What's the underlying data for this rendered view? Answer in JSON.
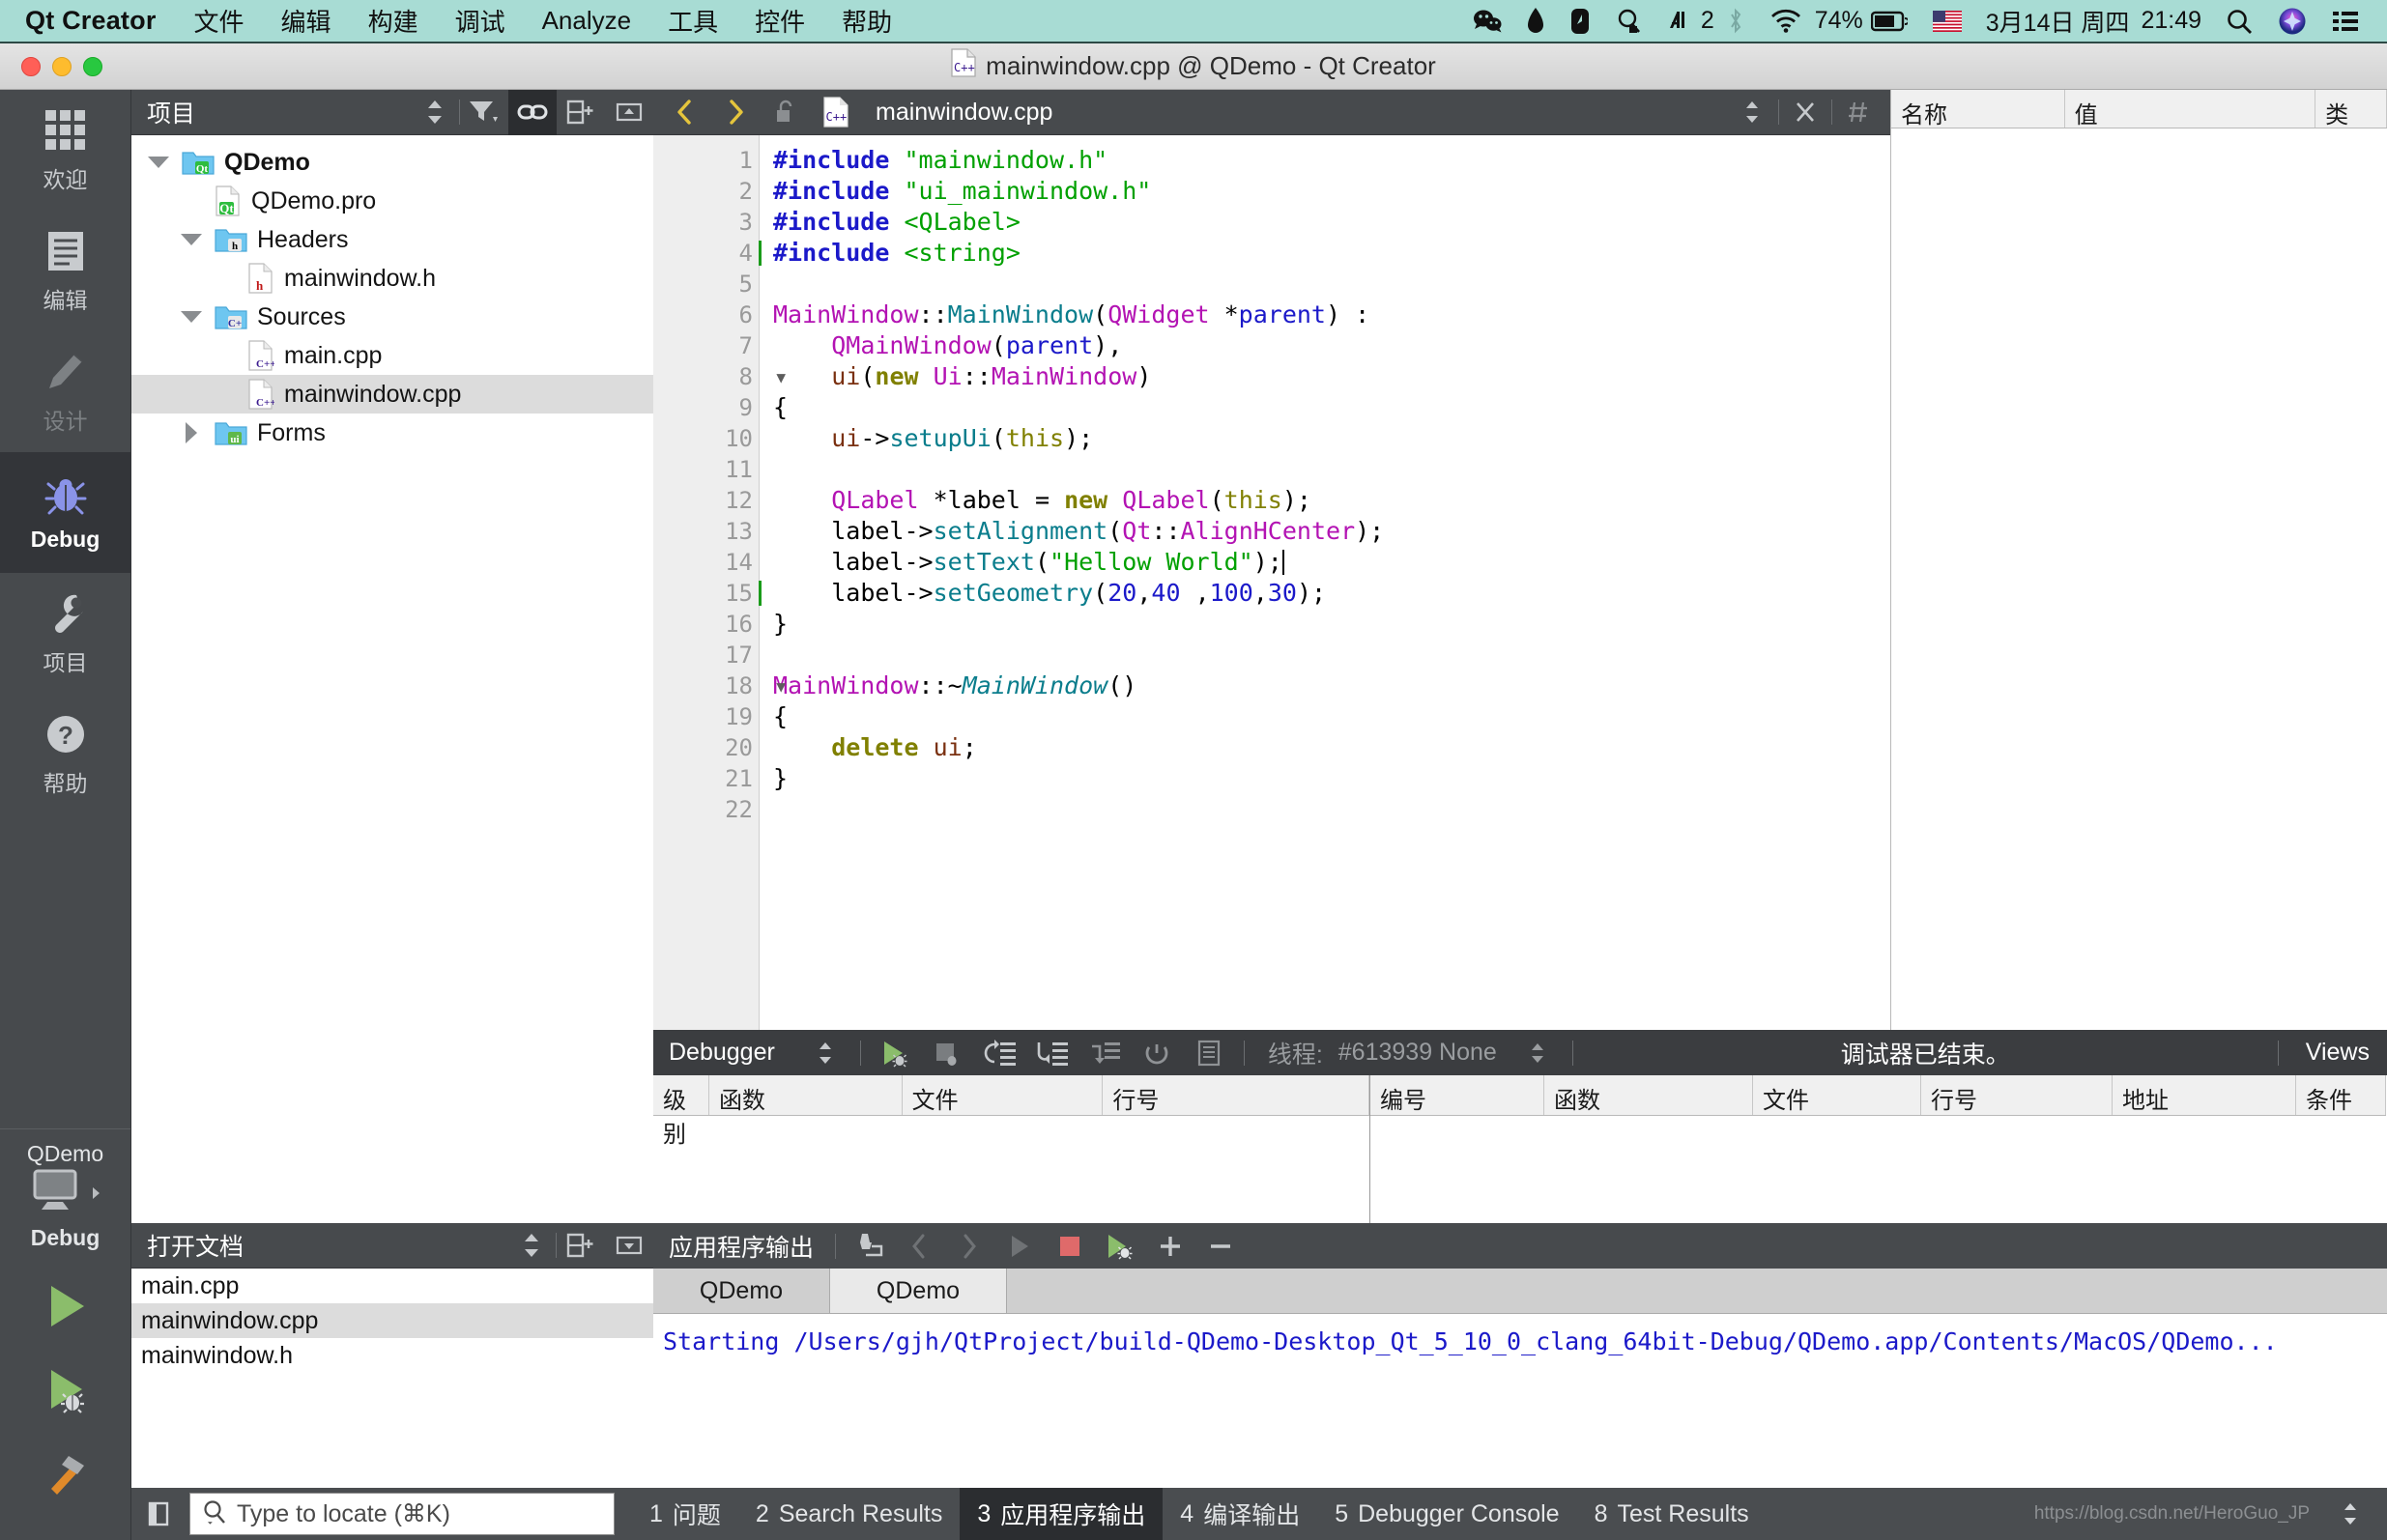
{
  "macbar": {
    "app_name": "Qt Creator",
    "menus": [
      "文件",
      "编辑",
      "构建",
      "调试",
      "Analyze",
      "工具",
      "控件",
      "帮助"
    ],
    "status_icons": [
      "wechat-icon",
      "fountain-pen-icon",
      "evernote-icon",
      "alfred-icon",
      "audio-2-icon"
    ],
    "audio_count": "2",
    "bluetooth_icon": "bluetooth-icon",
    "wifi_icon": "wifi-icon",
    "battery_percent": "74%",
    "input_source": "us-flag-icon",
    "date": "3月14日 周四",
    "time": "21:49",
    "spotlight_icon": "search-icon",
    "siri_icon": "siri-icon",
    "controlcenter_icon": "list-icon"
  },
  "window": {
    "title": "mainwindow.cpp @ QDemo - Qt Creator",
    "title_icon": "cpp-file-icon"
  },
  "modebar": {
    "items": [
      {
        "label": "欢迎",
        "icon": "grid-icon",
        "state": "normal"
      },
      {
        "label": "编辑",
        "icon": "document-icon",
        "state": "normal"
      },
      {
        "label": "设计",
        "icon": "pencil-icon",
        "state": "disabled"
      },
      {
        "label": "Debug",
        "icon": "bug-icon",
        "state": "active"
      },
      {
        "label": "项目",
        "icon": "wrench-icon",
        "state": "normal"
      },
      {
        "label": "帮助",
        "icon": "question-icon",
        "state": "normal"
      }
    ],
    "kit": {
      "project": "QDemo",
      "config": "Debug",
      "icon": "monitor-icon"
    },
    "run_buttons": [
      "run-icon",
      "debug-icon",
      "build-hammer-icon"
    ]
  },
  "project_panel": {
    "title": "项目",
    "tools": [
      "filter-selector-icon",
      "filter-funnel-icon",
      "link-sync-icon",
      "split-add-icon",
      "close-panel-icon"
    ],
    "tree": [
      {
        "label": "QDemo",
        "icon": "qt-folder-icon",
        "indent": 0,
        "arrow": "down",
        "bold": true,
        "selected": false
      },
      {
        "label": "QDemo.pro",
        "icon": "qt-file-icon",
        "indent": 1,
        "arrow": "none",
        "bold": false,
        "selected": false
      },
      {
        "label": "Headers",
        "icon": "h-folder-icon",
        "indent": 1,
        "arrow": "down",
        "bold": false,
        "selected": false
      },
      {
        "label": "mainwindow.h",
        "icon": "h-file-icon",
        "indent": 2,
        "arrow": "none",
        "bold": false,
        "selected": false
      },
      {
        "label": "Sources",
        "icon": "cpp-folder-icon",
        "indent": 1,
        "arrow": "down",
        "bold": false,
        "selected": false
      },
      {
        "label": "main.cpp",
        "icon": "cpp-file-icon",
        "indent": 2,
        "arrow": "none",
        "bold": false,
        "selected": false
      },
      {
        "label": "mainwindow.cpp",
        "icon": "cpp-file-icon",
        "indent": 2,
        "arrow": "none",
        "bold": false,
        "selected": true
      },
      {
        "label": "Forms",
        "icon": "ui-folder-icon",
        "indent": 1,
        "arrow": "right",
        "bold": false,
        "selected": false
      }
    ]
  },
  "open_documents": {
    "title": "打开文档",
    "tools": [
      "doc-selector-icon",
      "split-add-icon",
      "close-panel-icon"
    ],
    "items": [
      {
        "label": "main.cpp",
        "selected": false
      },
      {
        "label": "mainwindow.cpp",
        "selected": true
      },
      {
        "label": "mainwindow.h",
        "selected": false
      }
    ]
  },
  "editor": {
    "toolbar": {
      "back_icon": "chevron-left-icon",
      "forward_icon": "chevron-right-icon",
      "lock_icon": "unlock-icon",
      "file_icon": "cpp-file-icon",
      "filename": "mainwindow.cpp",
      "selector_icon": "updown-arrows-icon",
      "close_icon": "close-icon",
      "split_icon": "hash-icon"
    },
    "total_lines": 22,
    "cursor_line": 15,
    "fold_lines": [
      8,
      18
    ],
    "lines": [
      {
        "n": 1,
        "tokens": [
          {
            "t": "#include ",
            "c": "k-inc"
          },
          {
            "t": "\"mainwindow.h\"",
            "c": "k-str"
          }
        ]
      },
      {
        "n": 2,
        "tokens": [
          {
            "t": "#include ",
            "c": "k-inc"
          },
          {
            "t": "\"ui_mainwindow.h\"",
            "c": "k-str"
          }
        ]
      },
      {
        "n": 3,
        "tokens": [
          {
            "t": "#include ",
            "c": "k-inc"
          },
          {
            "t": "<QLabel>",
            "c": "k-str"
          }
        ]
      },
      {
        "n": 4,
        "tokens": [
          {
            "t": "#include ",
            "c": "k-inc"
          },
          {
            "t": "<string>",
            "c": "k-str"
          }
        ]
      },
      {
        "n": 5,
        "tokens": []
      },
      {
        "n": 6,
        "tokens": [
          {
            "t": "MainWindow",
            "c": "k-type"
          },
          {
            "t": "::",
            "c": "k-pl"
          },
          {
            "t": "MainWindow",
            "c": "k-fn"
          },
          {
            "t": "(",
            "c": "k-pl"
          },
          {
            "t": "QWidget",
            "c": "k-type"
          },
          {
            "t": " *",
            "c": "k-pl"
          },
          {
            "t": "parent",
            "c": "k-var"
          },
          {
            "t": ") :",
            "c": "k-pl"
          }
        ]
      },
      {
        "n": 7,
        "tokens": [
          {
            "t": "    ",
            "c": "k-pl"
          },
          {
            "t": "QMainWindow",
            "c": "k-type"
          },
          {
            "t": "(",
            "c": "k-pl"
          },
          {
            "t": "parent",
            "c": "k-var"
          },
          {
            "t": "),",
            "c": "k-pl"
          }
        ]
      },
      {
        "n": 8,
        "tokens": [
          {
            "t": "    ",
            "c": "k-pl"
          },
          {
            "t": "ui",
            "c": "k-mem"
          },
          {
            "t": "(",
            "c": "k-pl"
          },
          {
            "t": "new",
            "c": "k-kw"
          },
          {
            "t": " ",
            "c": "k-pl"
          },
          {
            "t": "Ui",
            "c": "k-type"
          },
          {
            "t": "::",
            "c": "k-pl"
          },
          {
            "t": "MainWindow",
            "c": "k-type"
          },
          {
            "t": ")",
            "c": "k-pl"
          }
        ]
      },
      {
        "n": 9,
        "tokens": [
          {
            "t": "{",
            "c": "k-pl"
          }
        ]
      },
      {
        "n": 10,
        "tokens": [
          {
            "t": "    ",
            "c": "k-pl"
          },
          {
            "t": "ui",
            "c": "k-mem"
          },
          {
            "t": "->",
            "c": "k-pl"
          },
          {
            "t": "setupUi",
            "c": "k-fn"
          },
          {
            "t": "(",
            "c": "k-pl"
          },
          {
            "t": "this",
            "c": "k-this"
          },
          {
            "t": ");",
            "c": "k-pl"
          }
        ]
      },
      {
        "n": 11,
        "tokens": []
      },
      {
        "n": 12,
        "tokens": [
          {
            "t": "    ",
            "c": "k-pl"
          },
          {
            "t": "QLabel",
            "c": "k-type"
          },
          {
            "t": " *",
            "c": "k-pl"
          },
          {
            "t": "label",
            "c": "k-pl"
          },
          {
            "t": " = ",
            "c": "k-pl"
          },
          {
            "t": "new",
            "c": "k-kw"
          },
          {
            "t": " ",
            "c": "k-pl"
          },
          {
            "t": "QLabel",
            "c": "k-type"
          },
          {
            "t": "(",
            "c": "k-pl"
          },
          {
            "t": "this",
            "c": "k-this"
          },
          {
            "t": ");",
            "c": "k-pl"
          }
        ]
      },
      {
        "n": 13,
        "tokens": [
          {
            "t": "    ",
            "c": "k-pl"
          },
          {
            "t": "label",
            "c": "k-pl"
          },
          {
            "t": "->",
            "c": "k-pl"
          },
          {
            "t": "setAlignment",
            "c": "k-fn"
          },
          {
            "t": "(",
            "c": "k-pl"
          },
          {
            "t": "Qt",
            "c": "k-type"
          },
          {
            "t": "::",
            "c": "k-pl"
          },
          {
            "t": "AlignHCenter",
            "c": "k-type"
          },
          {
            "t": ");",
            "c": "k-pl"
          }
        ]
      },
      {
        "n": 14,
        "tokens": [
          {
            "t": "    ",
            "c": "k-pl"
          },
          {
            "t": "label",
            "c": "k-pl"
          },
          {
            "t": "->",
            "c": "k-pl"
          },
          {
            "t": "setText",
            "c": "k-fn"
          },
          {
            "t": "(",
            "c": "k-pl"
          },
          {
            "t": "\"Hellow World\"",
            "c": "k-str"
          },
          {
            "t": ");",
            "c": "k-pl"
          }
        ],
        "caret_end": true
      },
      {
        "n": 15,
        "tokens": [
          {
            "t": "    ",
            "c": "k-pl"
          },
          {
            "t": "label",
            "c": "k-pl"
          },
          {
            "t": "->",
            "c": "k-pl"
          },
          {
            "t": "setGeometry",
            "c": "k-fn"
          },
          {
            "t": "(",
            "c": "k-pl"
          },
          {
            "t": "20",
            "c": "k-num"
          },
          {
            "t": ",",
            "c": "k-pl"
          },
          {
            "t": "40",
            "c": "k-num"
          },
          {
            "t": " ,",
            "c": "k-pl"
          },
          {
            "t": "100",
            "c": "k-num"
          },
          {
            "t": ",",
            "c": "k-pl"
          },
          {
            "t": "30",
            "c": "k-num"
          },
          {
            "t": ");",
            "c": "k-pl"
          }
        ]
      },
      {
        "n": 16,
        "tokens": [
          {
            "t": "}",
            "c": "k-pl"
          }
        ]
      },
      {
        "n": 17,
        "tokens": []
      },
      {
        "n": 18,
        "tokens": [
          {
            "t": "MainWindow",
            "c": "k-type"
          },
          {
            "t": "::~",
            "c": "k-pl"
          },
          {
            "t": "MainWindow",
            "c": "k-it"
          },
          {
            "t": "()",
            "c": "k-pl"
          }
        ]
      },
      {
        "n": 19,
        "tokens": [
          {
            "t": "{",
            "c": "k-pl"
          }
        ]
      },
      {
        "n": 20,
        "tokens": [
          {
            "t": "    ",
            "c": "k-pl"
          },
          {
            "t": "delete",
            "c": "k-kw"
          },
          {
            "t": " ",
            "c": "k-pl"
          },
          {
            "t": "ui",
            "c": "k-mem"
          },
          {
            "t": ";",
            "c": "k-pl"
          }
        ]
      },
      {
        "n": 21,
        "tokens": [
          {
            "t": "}",
            "c": "k-pl"
          }
        ]
      },
      {
        "n": 22,
        "tokens": []
      }
    ]
  },
  "right_pane": {
    "columns": [
      "名称",
      "值",
      "类"
    ]
  },
  "debugger": {
    "title": "Debugger",
    "selector_icon": "updown-arrows-icon",
    "buttons": [
      "continue-icon",
      "stop-icon",
      "step-over-icon",
      "step-into-icon",
      "step-out-icon",
      "restart-icon",
      "instruction-view-icon"
    ],
    "thread_label": "线程:",
    "thread_value": "#613939 None",
    "status": "调试器已结束。",
    "views_label": "Views",
    "stack_columns": [
      "级别",
      "函数",
      "文件",
      "行号"
    ],
    "breakpoint_columns": [
      "编号",
      "函数",
      "文件",
      "行号",
      "地址",
      "条件"
    ]
  },
  "app_output": {
    "title": "应用程序输出",
    "buttons": [
      "clear-icon",
      "prev-icon",
      "next-icon",
      "run-gray-icon",
      "stop-red-icon",
      "debug-green-icon",
      "zoom-in-icon",
      "zoom-out-icon"
    ],
    "tabs": [
      {
        "label": "QDemo",
        "selected": false
      },
      {
        "label": "QDemo",
        "selected": true
      }
    ],
    "text": "Starting /Users/gjh/QtProject/build-QDemo-Desktop_Qt_5_10_0_clang_64bit-Debug/QDemo.app/Contents/MacOS/QDemo..."
  },
  "statusbar": {
    "sidebar_toggle_icon": "sidebar-icon",
    "locator_placeholder": "Type to locate (⌘K)",
    "locator_icon": "search-icon",
    "tabs": [
      {
        "num": "1",
        "label": "问题",
        "selected": false
      },
      {
        "num": "2",
        "label": "Search Results",
        "selected": false
      },
      {
        "num": "3",
        "label": "应用程序输出",
        "selected": true
      },
      {
        "num": "4",
        "label": "编译输出",
        "selected": false
      },
      {
        "num": "5",
        "label": "Debugger Console",
        "selected": false
      },
      {
        "num": "8",
        "label": "Test Results",
        "selected": false
      }
    ],
    "more_icon": "updown-arrows-icon",
    "watermark": "https://blog.csdn.net/HeroGuo_JP"
  }
}
